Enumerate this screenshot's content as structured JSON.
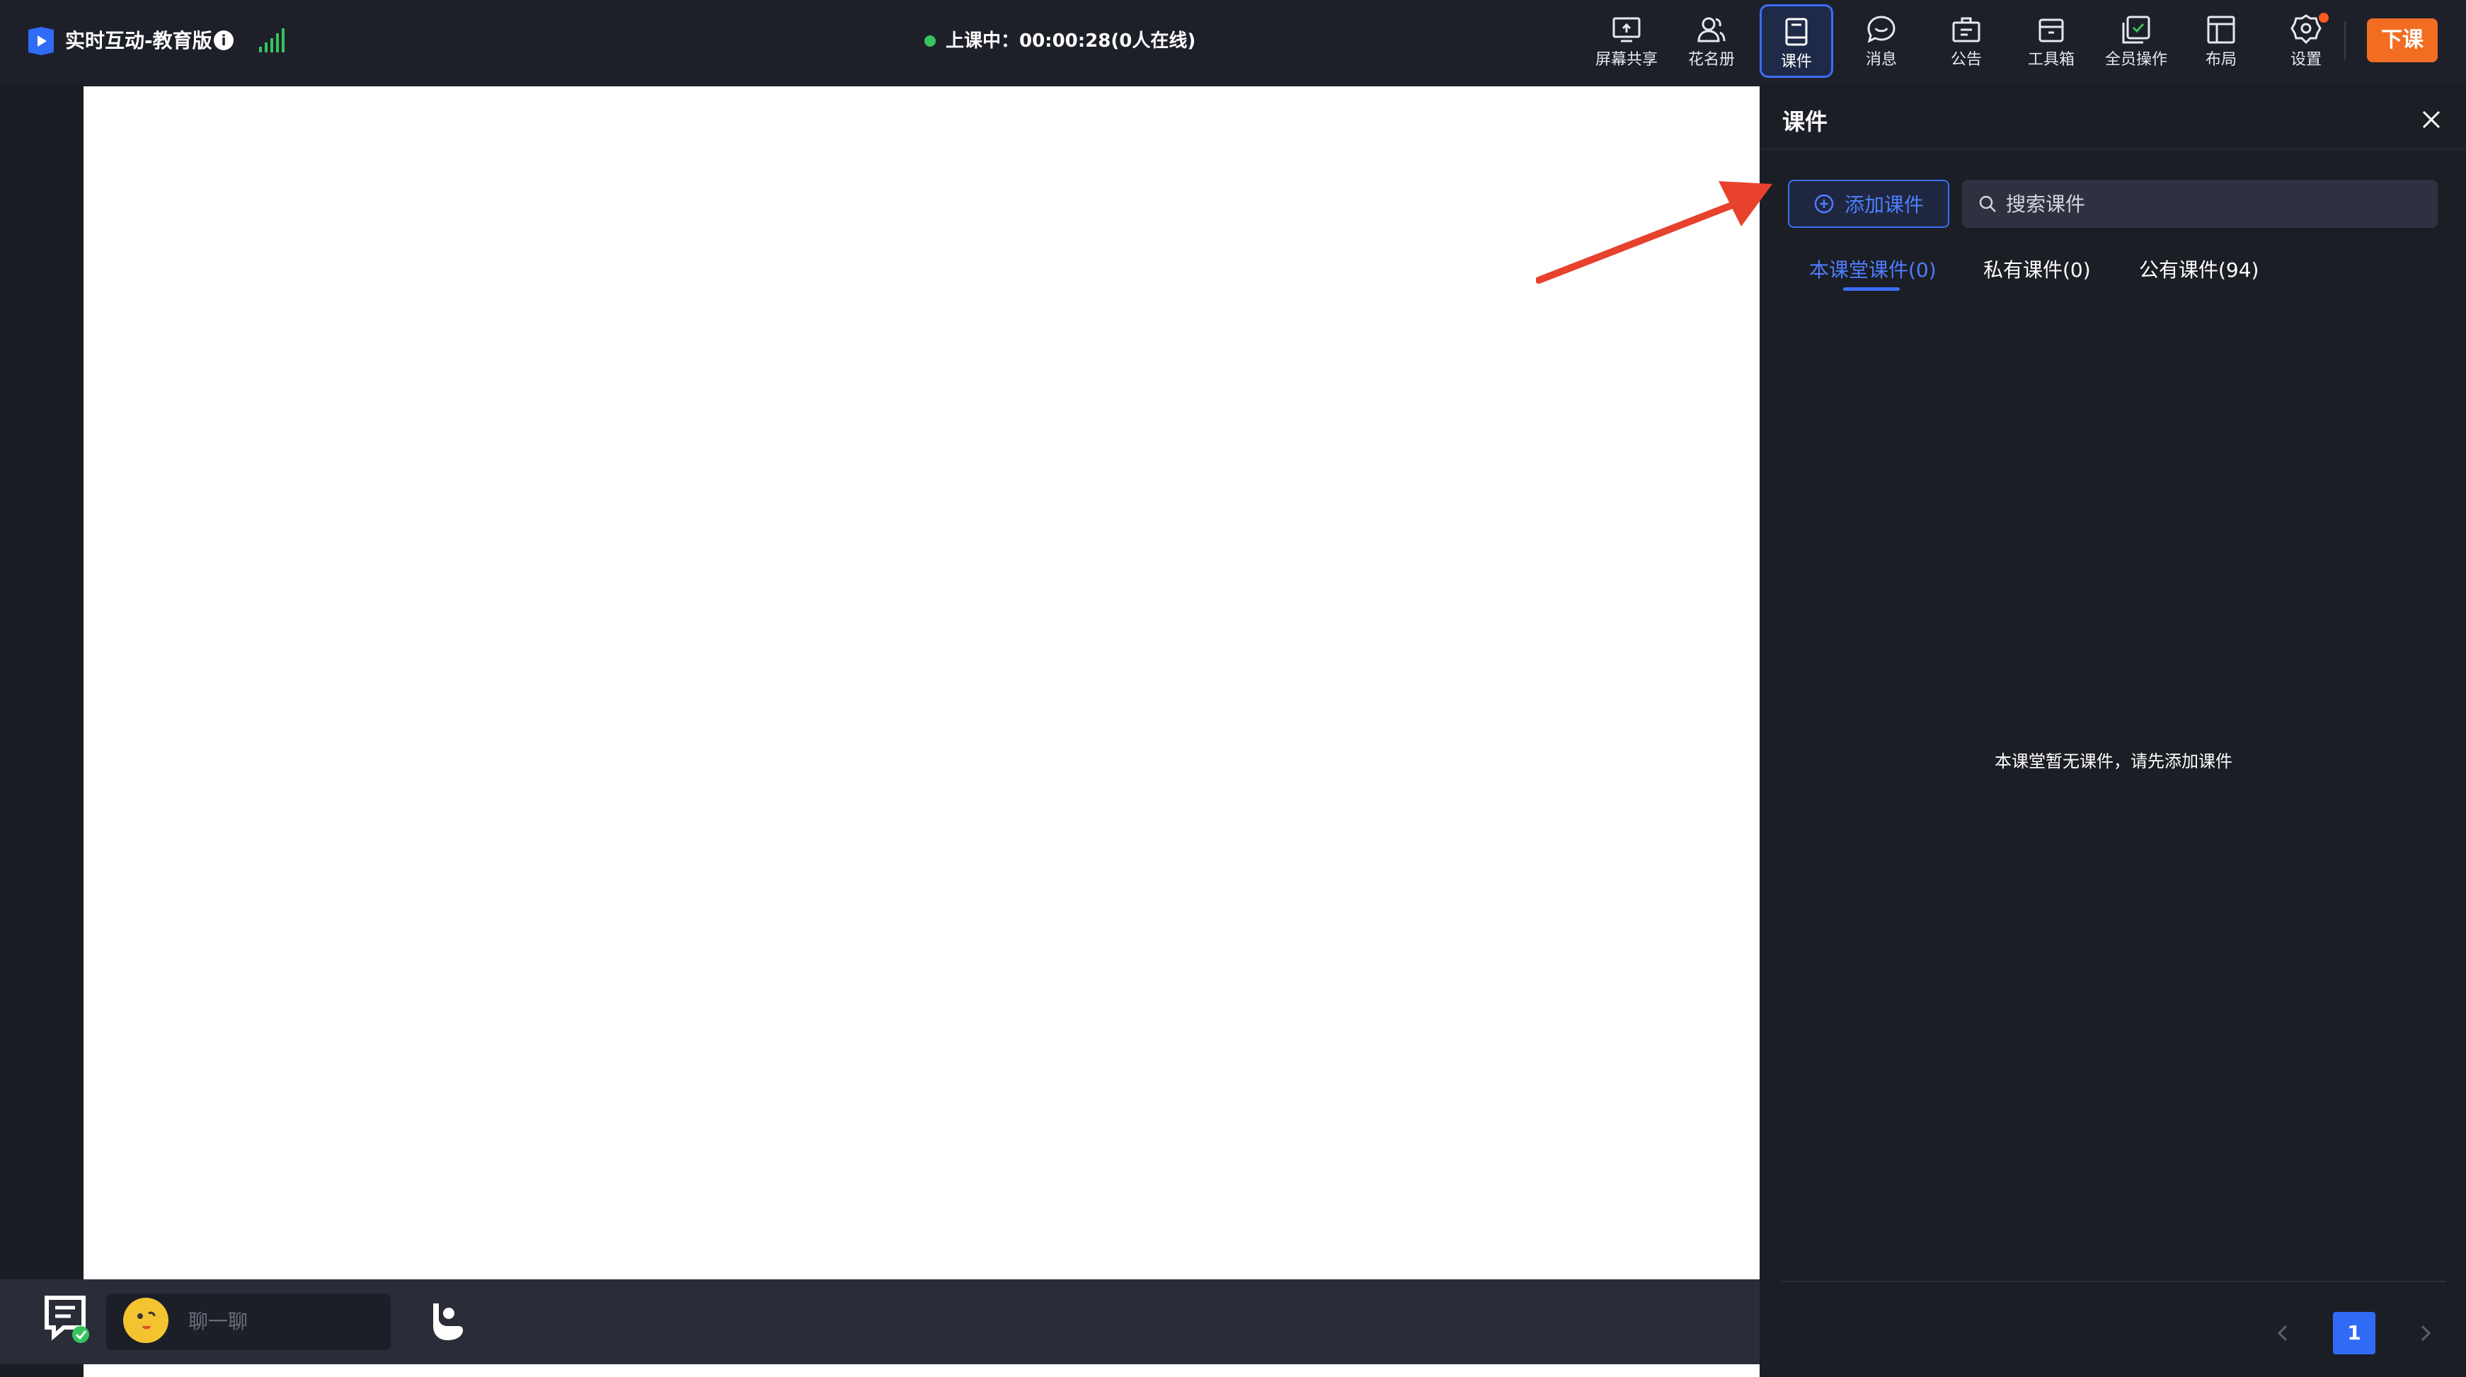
{
  "header": {
    "app_title": "实时互动-教育版",
    "status_text": "上课中：00:00:28(0人在线)"
  },
  "toolbar": {
    "items": [
      {
        "label": "屏幕共享",
        "icon": "screen-share-icon"
      },
      {
        "label": "花名册",
        "icon": "roster-icon"
      },
      {
        "label": "课件",
        "icon": "courseware-icon"
      },
      {
        "label": "消息",
        "icon": "message-icon"
      },
      {
        "label": "公告",
        "icon": "announcement-icon"
      },
      {
        "label": "工具箱",
        "icon": "toolbox-icon"
      },
      {
        "label": "全员操作",
        "icon": "all-members-icon"
      },
      {
        "label": "布局",
        "icon": "layout-icon"
      },
      {
        "label": "设置",
        "icon": "settings-icon"
      }
    ],
    "active": "课件",
    "end_class_label": "下课"
  },
  "chat": {
    "placeholder": "聊一聊"
  },
  "panel": {
    "title": "课件",
    "add_button_label": "添加课件",
    "search_placeholder": "搜索课件",
    "tabs": [
      {
        "label": "本课堂课件(0)",
        "active": true
      },
      {
        "label": "私有课件(0)",
        "active": false
      },
      {
        "label": "公有课件(94)",
        "active": false
      }
    ],
    "empty_message": "本课堂暂无课件，请先添加课件",
    "pagination": {
      "current_page": "1"
    }
  },
  "colors": {
    "accent": "#3b6ef5",
    "end_button": "#f26d21",
    "status_online": "#36c25d",
    "annotation_arrow": "#e8412c"
  }
}
